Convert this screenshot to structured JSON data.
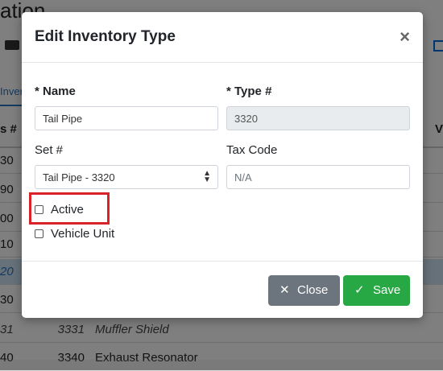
{
  "background": {
    "page_title": "ation",
    "tab_label": "Inver",
    "header_col1": "s #",
    "header_col2": "V",
    "rows": [
      {
        "num": "30"
      },
      {
        "num": "90"
      },
      {
        "num": "00"
      },
      {
        "num": "10"
      },
      {
        "num": "20"
      },
      {
        "num": "30"
      },
      {
        "num": "31",
        "number": "3331",
        "description": "Muffler Shield"
      },
      {
        "num": "40",
        "number": "3340",
        "description": "Exhaust Resonator"
      }
    ]
  },
  "modal": {
    "title": "Edit Inventory Type",
    "close_icon": "×",
    "name_label": "* Name",
    "name_value": "Tail Pipe",
    "type_label": "* Type #",
    "type_value": "3320",
    "set_label": "Set #",
    "set_value": "Tail Pipe - 3320",
    "tax_label": "Tax Code",
    "tax_placeholder": "N/A",
    "active_label": "Active",
    "active_checked": false,
    "vehicle_label": "Vehicle Unit",
    "vehicle_checked": false,
    "close_button": "Close",
    "save_button": "Save"
  },
  "colors": {
    "save_green": "#28a745",
    "close_gray": "#6c757d",
    "highlight_red": "#d9232a"
  }
}
